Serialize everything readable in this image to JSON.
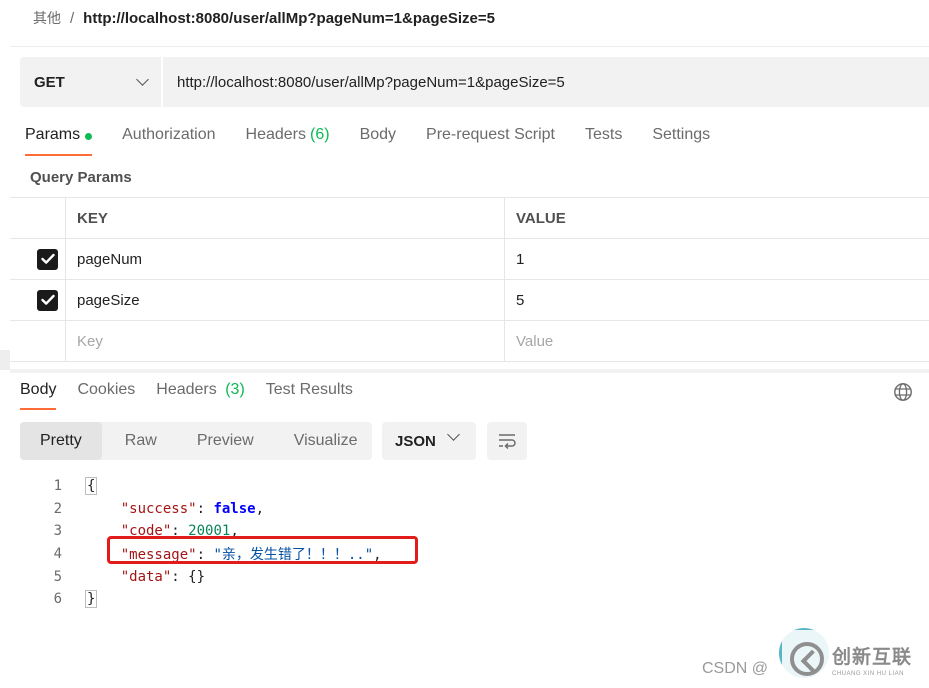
{
  "breadcrumb": {
    "parent": "其他",
    "separator": "/",
    "current": "http://localhost:8080/user/allMp?pageNum=1&pageSize=5"
  },
  "request": {
    "method": "GET",
    "url": "http://localhost:8080/user/allMp?pageNum=1&pageSize=5"
  },
  "request_tabs": {
    "params": "Params",
    "authorization": "Authorization",
    "headers": "Headers",
    "headers_count": "(6)",
    "body": "Body",
    "prerequest": "Pre-request Script",
    "tests": "Tests",
    "settings": "Settings"
  },
  "query_params": {
    "title": "Query Params",
    "columns": {
      "key": "KEY",
      "value": "VALUE"
    },
    "rows": [
      {
        "key": "pageNum",
        "value": "1",
        "checked": true
      },
      {
        "key": "pageSize",
        "value": "5",
        "checked": true
      }
    ],
    "placeholder": {
      "key": "Key",
      "value": "Value"
    }
  },
  "response_tabs": {
    "body": "Body",
    "cookies": "Cookies",
    "headers": "Headers",
    "headers_count": "(3)",
    "test_results": "Test Results"
  },
  "format_tabs": {
    "pretty": "Pretty",
    "raw": "Raw",
    "preview": "Preview",
    "visualize": "Visualize"
  },
  "language": "JSON",
  "response_body": {
    "line_numbers": [
      "1",
      "2",
      "3",
      "4",
      "5",
      "6"
    ],
    "open_brace": "{",
    "close_brace": "}",
    "success_key": "\"success\"",
    "success_value": "false",
    "code_key": "\"code\"",
    "code_value": "20001",
    "message_key": "\"message\"",
    "message_value": "\"亲，发生错了！！！..\"",
    "data_key": "\"data\"",
    "data_value": "{}"
  },
  "watermark": {
    "text": "CSDN @",
    "logo_cn": "创新互联",
    "logo_en": "CHUANG XIN HU LIAN"
  },
  "colors": {
    "accent": "#ff6c37",
    "green": "#0cbb52",
    "highlight": "#e21b1b"
  }
}
